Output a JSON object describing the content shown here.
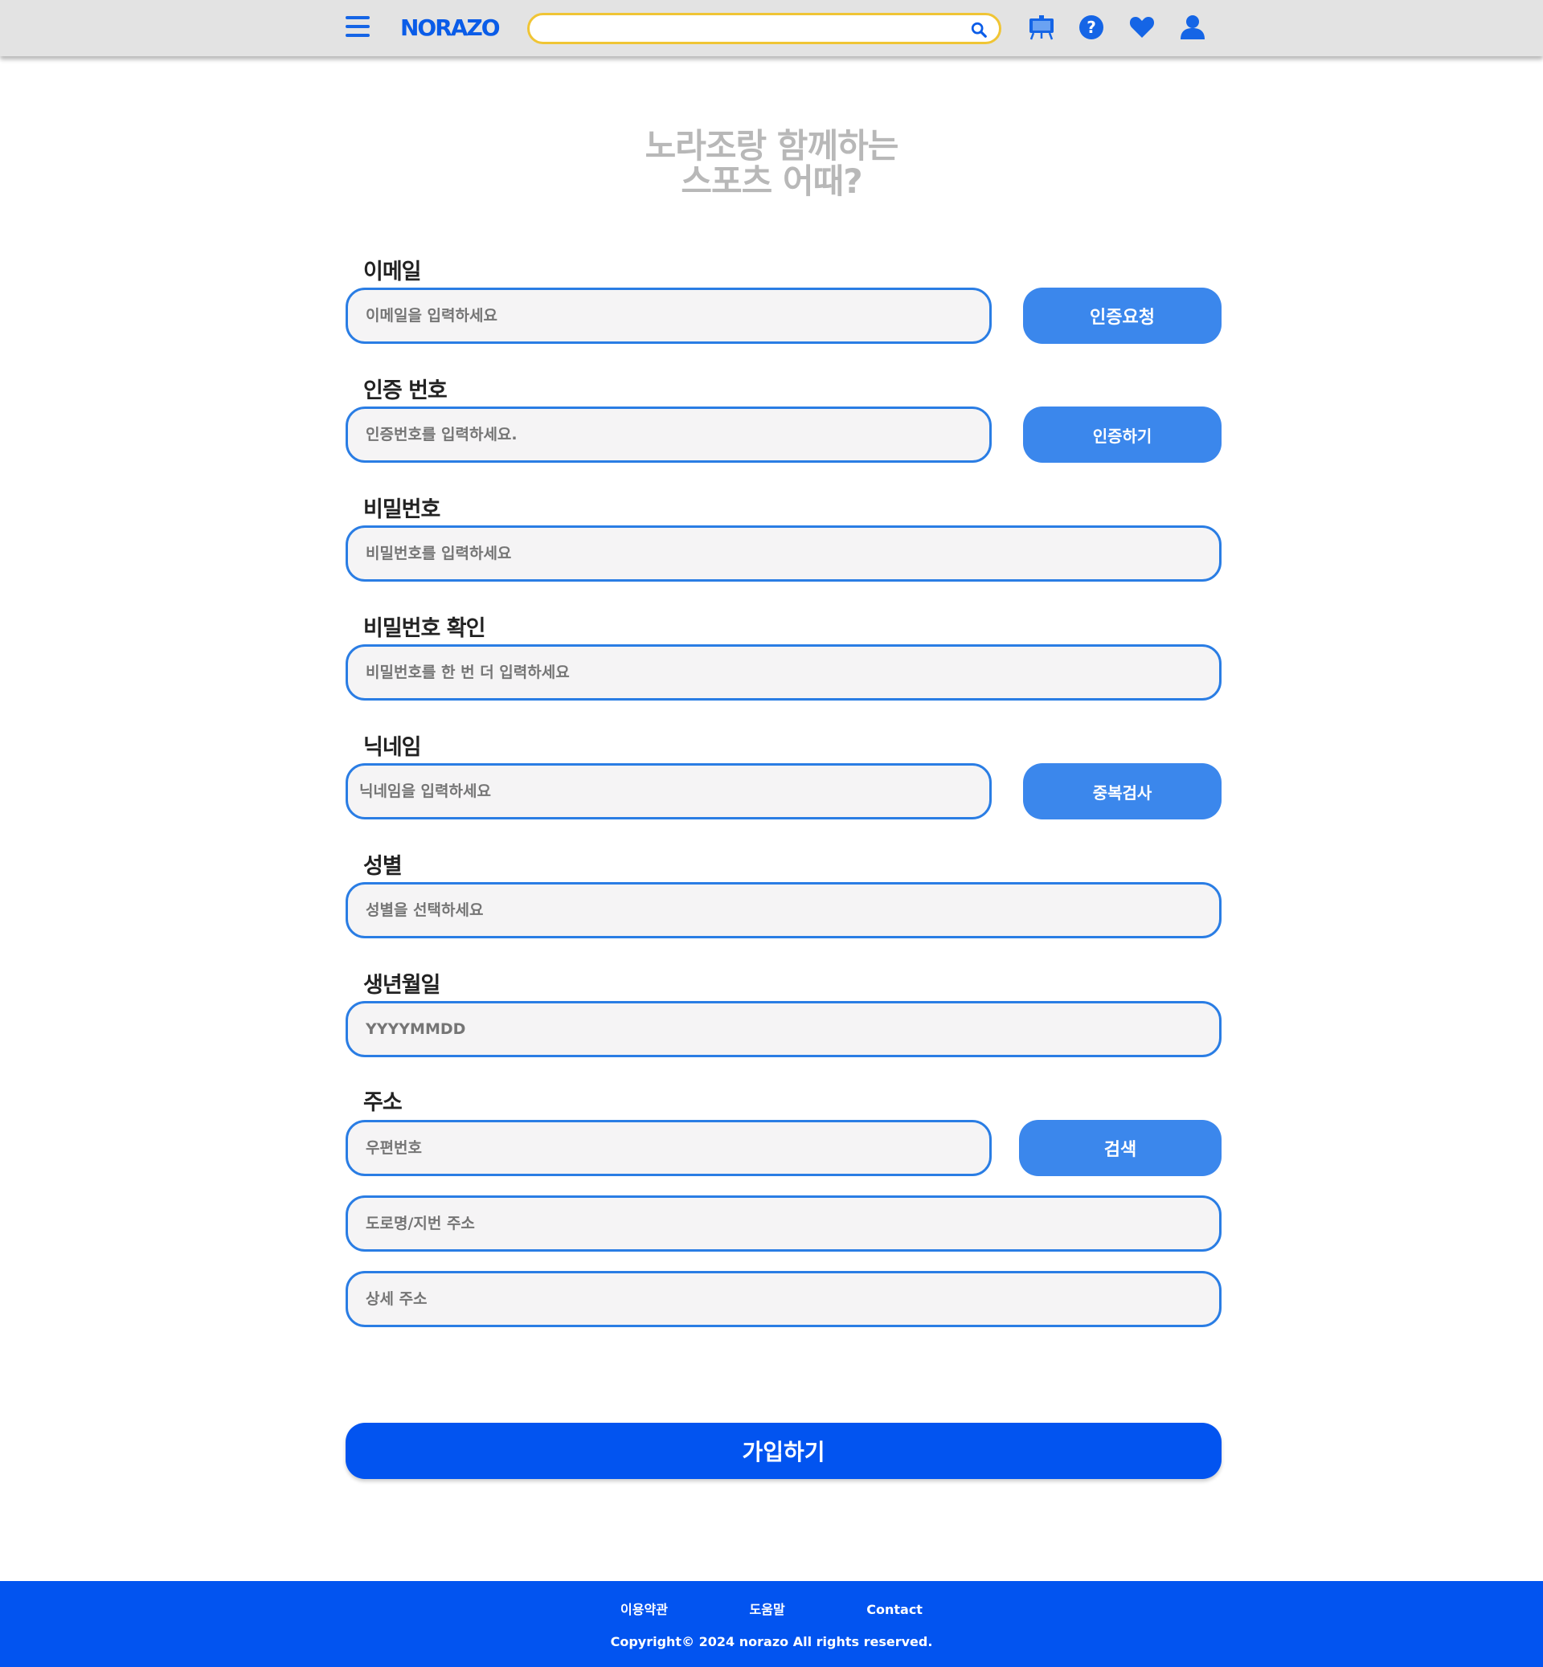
{
  "header": {
    "logo": "NORAZO",
    "search_placeholder": "",
    "colors": {
      "bar": "#e3e3e3",
      "accent": "#0a5ce8",
      "search_border": "#f0c535"
    },
    "icons": [
      "menu-icon",
      "search-icon",
      "board-icon",
      "help-icon",
      "heart-icon",
      "user-icon"
    ]
  },
  "heading": {
    "line1": "노라조랑 함께하는",
    "line2": "스포츠 어때?"
  },
  "form": {
    "email": {
      "label": "이메일",
      "placeholder": "이메일을 입력하세요",
      "button": "인증요청"
    },
    "code": {
      "label": "인증 번호",
      "placeholder": "인증번호를 입력하세요.",
      "button": "인증하기"
    },
    "password": {
      "label": "비밀번호",
      "placeholder": "비밀번호를 입력하세요"
    },
    "password_confirm": {
      "label": "비밀번호 확인",
      "placeholder": "비밀번호를 한 번 더 입력하세요"
    },
    "nickname": {
      "label": "닉네임",
      "placeholder": "닉네임을 입력하세요",
      "button": "중복검사"
    },
    "gender": {
      "label": "성별",
      "placeholder": "성별을 선택하세요"
    },
    "birth": {
      "label": "생년월일",
      "placeholder": "YYYYMMDD"
    },
    "address": {
      "label": "주소",
      "zip_placeholder": "우편번호",
      "button": "검색",
      "road_placeholder": "도로명/지번 주소",
      "detail_placeholder": "상세 주소"
    },
    "submit": "가입하기"
  },
  "footer": {
    "links": [
      "이용약관",
      "도움말",
      "Contact"
    ],
    "copyright": "Copyright© 2024 norazo All rights reserved."
  }
}
